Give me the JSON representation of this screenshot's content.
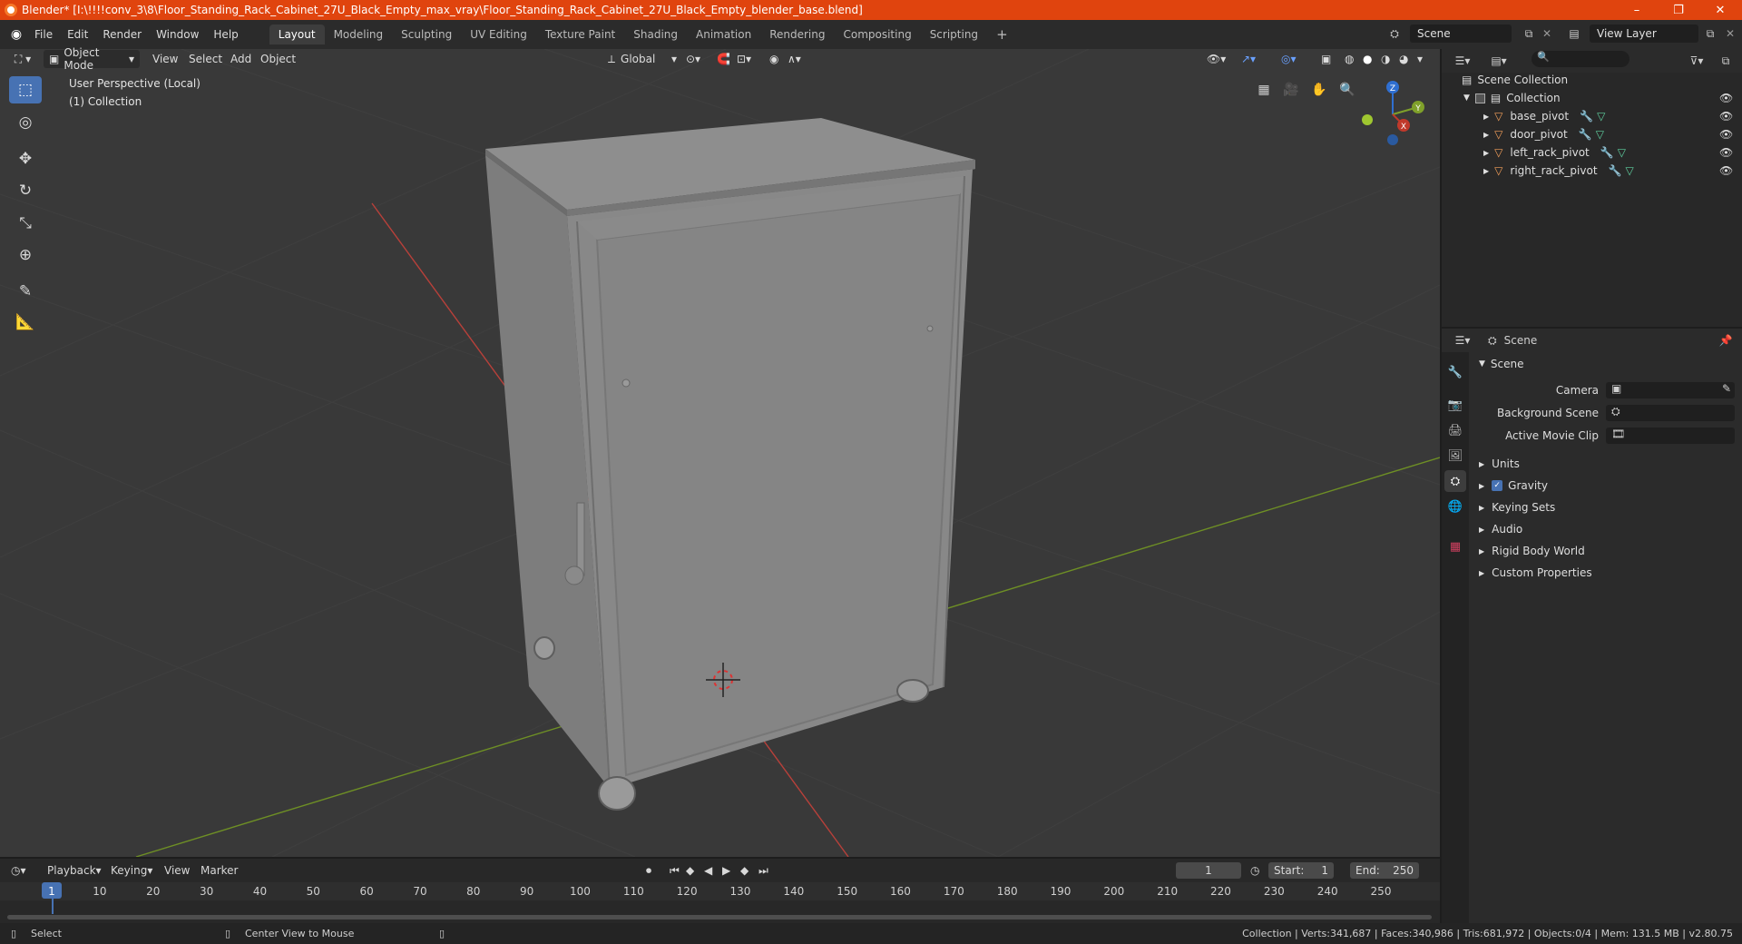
{
  "window": {
    "title": "Blender* [I:\\!!!!conv_3\\8\\Floor_Standing_Rack_Cabinet_27U_Black_Empty_max_vray\\Floor_Standing_Rack_Cabinet_27U_Black_Empty_blender_base.blend]",
    "min": "–",
    "max": "❐",
    "close": "✕"
  },
  "menu": [
    "File",
    "Edit",
    "Render",
    "Window",
    "Help"
  ],
  "workspaces": [
    "Layout",
    "Modeling",
    "Sculpting",
    "UV Editing",
    "Texture Paint",
    "Shading",
    "Animation",
    "Rendering",
    "Compositing",
    "Scripting"
  ],
  "workspace_add": "+",
  "scene_name": "Scene",
  "view_layer": "View Layer",
  "viewport": {
    "mode": "Object Mode",
    "menus": [
      "View",
      "Select",
      "Add",
      "Object"
    ],
    "orientation": "Global",
    "info_line1": "User Perspective (Local)",
    "info_line2": "(1) Collection",
    "gizmo": {
      "z": "Z",
      "y": "Y",
      "x": "X"
    }
  },
  "outliner": {
    "root": "Scene Collection",
    "collection": "Collection",
    "items": [
      "base_pivot",
      "door_pivot",
      "left_rack_pivot",
      "right_rack_pivot"
    ]
  },
  "properties": {
    "header": "Scene",
    "panel": "Scene",
    "camera_label": "Camera",
    "background_label": "Background Scene",
    "movie_clip_label": "Active Movie Clip",
    "sections": [
      "Units",
      "Gravity",
      "Keying Sets",
      "Audio",
      "Rigid Body World",
      "Custom Properties"
    ]
  },
  "timeline": {
    "menus": [
      "Playback",
      "Keying",
      "View",
      "Marker"
    ],
    "current_frame": "1",
    "start_label": "Start:",
    "start": "1",
    "end_label": "End:",
    "end": "250",
    "ticks": [
      "1",
      "10",
      "20",
      "30",
      "40",
      "50",
      "60",
      "70",
      "80",
      "90",
      "100",
      "110",
      "120",
      "130",
      "140",
      "150",
      "160",
      "170",
      "180",
      "190",
      "200",
      "210",
      "220",
      "230",
      "240",
      "250"
    ]
  },
  "status": {
    "select": "Select",
    "center": "Center View to Mouse",
    "stats": "Collection | Verts:341,687 | Faces:340,986 | Tris:681,972 | Objects:0/4 | Mem: 131.5 MB | v2.80.75"
  },
  "colors": {
    "title_bar": "#e0440e",
    "accent": "#4772b3",
    "viewport": "#393939",
    "x_axis": "#c0392b",
    "y_axis": "#7fa02a"
  }
}
